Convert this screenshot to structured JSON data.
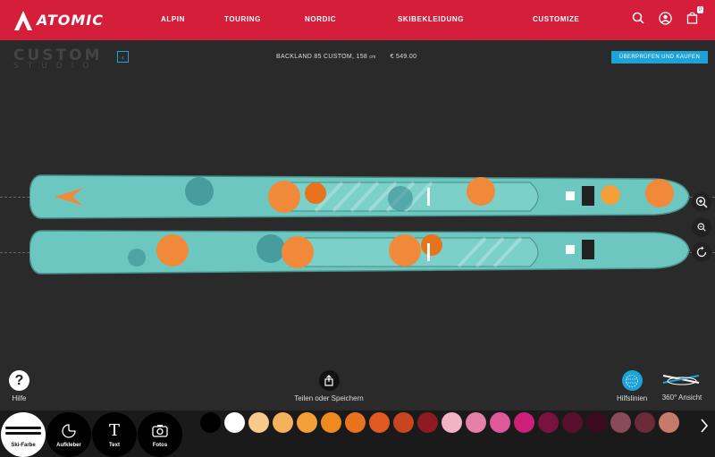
{
  "brand": {
    "name": "ATOMIC"
  },
  "nav": {
    "items": [
      {
        "label": "ALPIN"
      },
      {
        "label": "TOURING"
      },
      {
        "label": "NORDIC"
      },
      {
        "label": "SKIBEKLEIDUNG"
      },
      {
        "label": "CUSTOMIZE"
      }
    ],
    "cart_count": "0"
  },
  "studio": {
    "title_line1": "CUSTOM",
    "title_line2": "STUDIO",
    "back_glyph": "‹"
  },
  "product": {
    "name": "BACKLAND 85 CUSTOM, 158",
    "unit": "cm",
    "price": "€ 549.00"
  },
  "buy_button": {
    "label": "ÜBERPRÜFEN UND KAUFEN"
  },
  "tools": {
    "help": {
      "glyph": "?",
      "label": "Hilfe"
    },
    "share": {
      "label": "Teilen oder Speichern"
    },
    "guides": {
      "label": "Hilfslinien"
    },
    "view360": {
      "label": "360° Ansicht"
    }
  },
  "tabs": [
    {
      "label": "Ski-Farbe",
      "icon": "ski-icon",
      "active": true
    },
    {
      "label": "Aufkleber",
      "icon": "sticker-icon",
      "active": false
    },
    {
      "label": "Text",
      "icon": "text-icon",
      "glyph": "T",
      "active": false
    },
    {
      "label": "Fotos",
      "icon": "camera-icon",
      "active": false
    }
  ],
  "colors": {
    "brand_red": "#d51f3a",
    "accent_blue": "#1ea3d8",
    "ski_base": "#6cc7c1",
    "flower_orange": "#f08a3a",
    "swatches": [
      "#000000",
      "#ffffff",
      "#f7c98a",
      "#f4b25c",
      "#f3a03a",
      "#ef8a1e",
      "#e8731e",
      "#e05a22",
      "#c8461e",
      "#8e1a22",
      "#f2b3c6",
      "#e580a8",
      "#de5a9a",
      "#cc1f7a",
      "#7a1240",
      "#5a0f2e",
      "#3c0a20",
      "#8a4a58",
      "#6a2a38",
      "#c87a6a"
    ]
  }
}
